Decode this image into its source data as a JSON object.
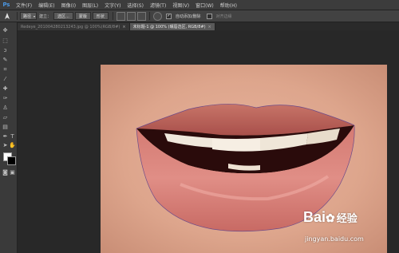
{
  "app": {
    "logo": "Ps"
  },
  "menu": [
    "文件(F)",
    "编辑(E)",
    "图像(I)",
    "图层(L)",
    "文字(Y)",
    "选择(S)",
    "滤镜(T)",
    "视图(V)",
    "窗口(W)",
    "帮助(H)"
  ],
  "options": {
    "tool_icon": "pen-icon",
    "mode_select": "路径",
    "create_label": "建立：",
    "selection_btn": "选区...",
    "mask_btn": "蒙版",
    "shape_btn": "形状",
    "auto_add_delete": "自动添加/删除",
    "align_edges": "对齐边缘"
  },
  "tabs": [
    {
      "label": "Redeye_201004280213243.jpg @ 100%(RGB/8#)",
      "close": "×",
      "active": false
    },
    {
      "label": "未标题-1 @ 100% (嘴唇选区, RGB/8#)",
      "close": "×",
      "active": true
    }
  ],
  "colors": {
    "foreground": "#ffffff",
    "background": "#000000"
  },
  "watermark": {
    "logo": "Bai",
    "logo_suffix": "经验",
    "url": "jingyan.baidu.com"
  }
}
